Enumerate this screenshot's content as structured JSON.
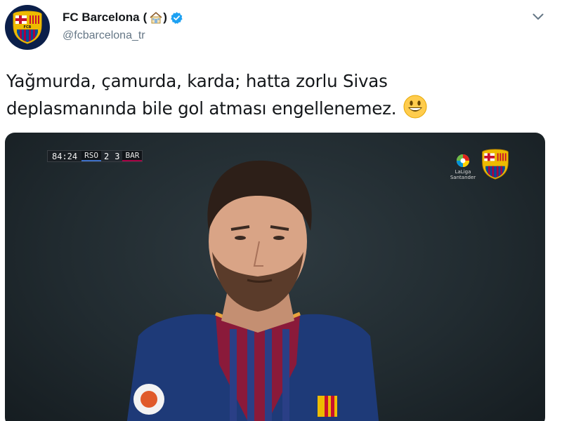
{
  "tweet": {
    "display_name": "FC Barcelona",
    "name_open_paren": "(",
    "name_close_paren": ")",
    "handle": "@fcbarcelona_tr",
    "text": "Yağmurda, çamurda, karda; hatta zorlu Sivas deplasmanında bile gol atması engellenemez.",
    "emoji": "smiling-face-icon"
  },
  "media": {
    "scoreboard": {
      "time": "84:24",
      "home_team": "RSO",
      "home_score": "2",
      "away_score": "3",
      "away_team": "BAR"
    },
    "broadcaster_text_line1": "LaLiga",
    "broadcaster_text_line2": "Santander"
  },
  "colors": {
    "verified": "#1da1f2",
    "handle": "#657786",
    "text": "#14171a",
    "barca_blue": "#004d98",
    "barca_red": "#a50044"
  }
}
